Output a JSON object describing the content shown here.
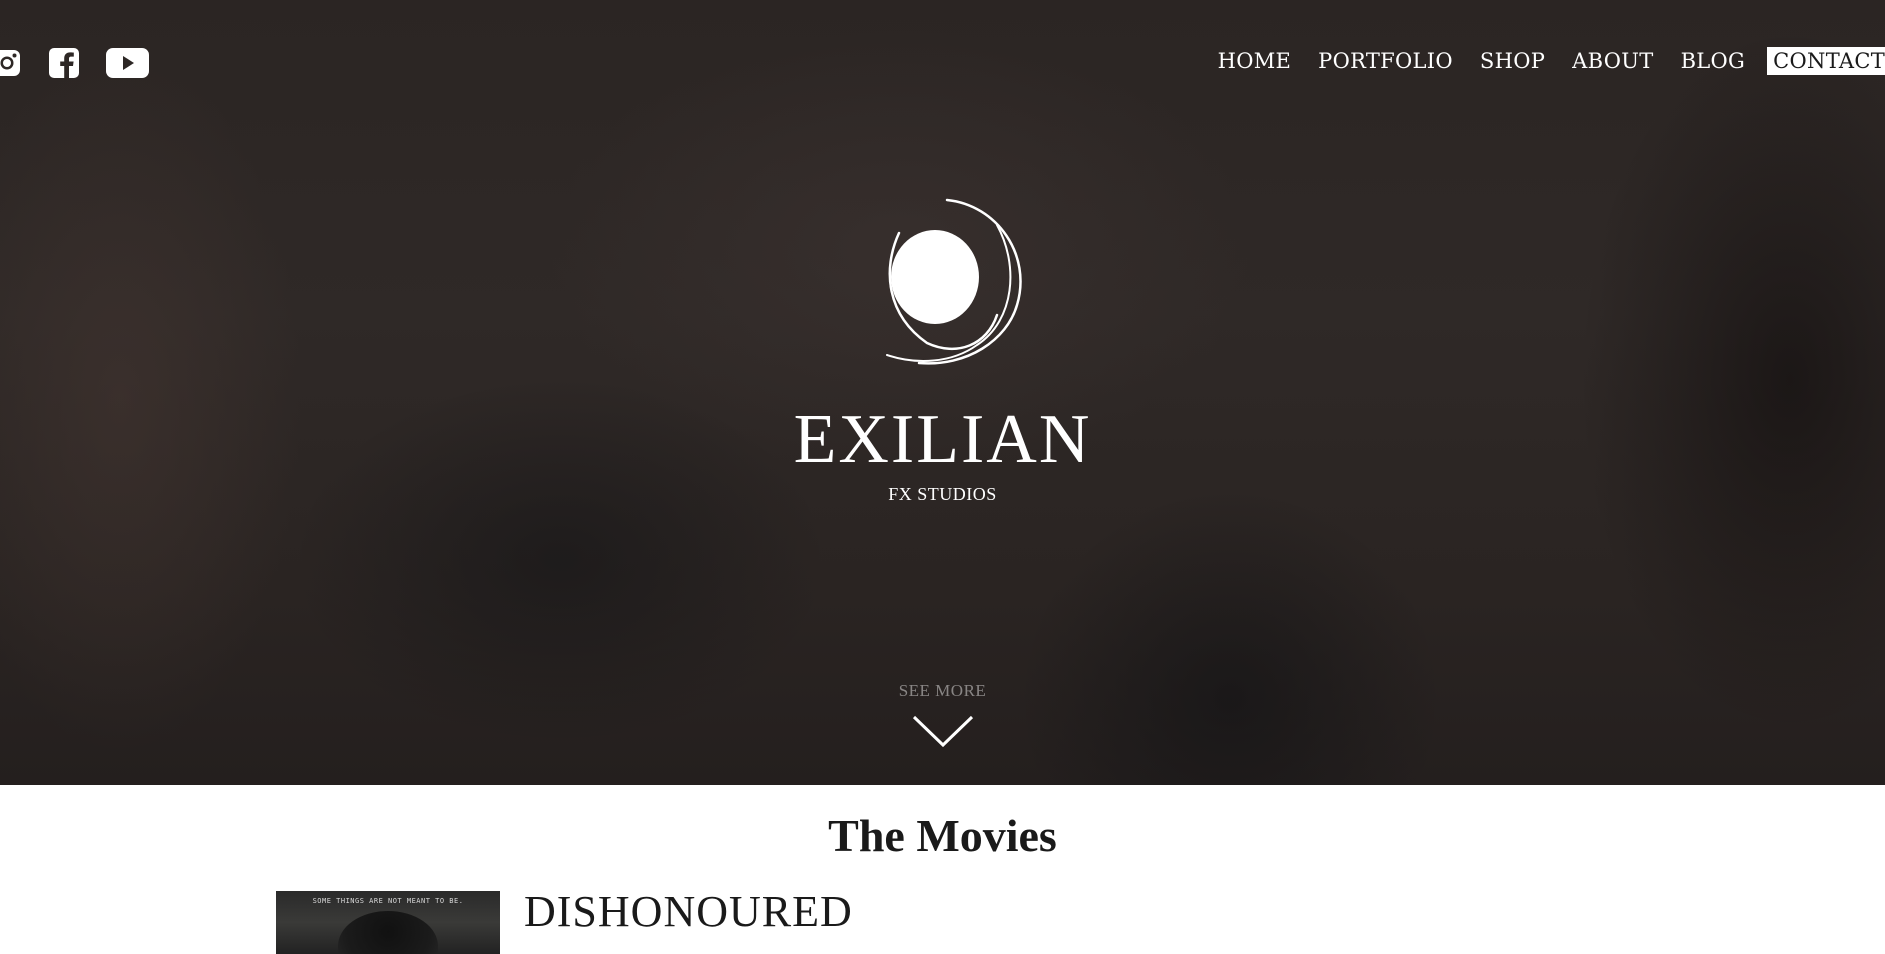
{
  "nav": {
    "items": [
      {
        "label": "HOME"
      },
      {
        "label": "PORTFOLIO"
      },
      {
        "label": "SHOP"
      },
      {
        "label": "ABOUT"
      },
      {
        "label": "BLOG"
      },
      {
        "label": "CONTACT"
      }
    ],
    "active": "CONTACT"
  },
  "social": {
    "icons": [
      "instagram-icon",
      "facebook-icon",
      "youtube-icon"
    ]
  },
  "hero": {
    "brand": "EXILIAN",
    "tagline": "FX STUDIOS",
    "see_more": "SEE MORE"
  },
  "movies": {
    "section_title": "The Movies",
    "items": [
      {
        "title": "DISHONOURED",
        "poster_tagline": "SOME THINGS ARE NOT MEANT TO BE."
      }
    ]
  },
  "colors": {
    "hero_bg": "#2d2725",
    "text_light": "#ffffff",
    "text_dark": "#1a1a1a",
    "active_nav_bg": "#ffffff"
  }
}
